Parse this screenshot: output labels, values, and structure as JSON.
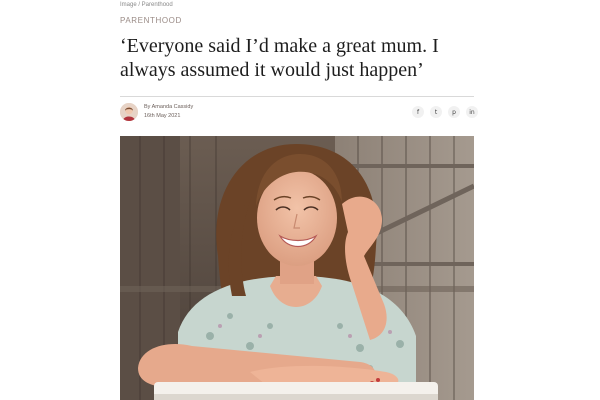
{
  "breadcrumb": "Image / Parenthood",
  "section": "PARENTHOOD",
  "headline": "‘Everyone said I’d make a great mum. I always assumed it would just happen’",
  "byline": {
    "author": "By Amanda Cassidy",
    "date": "16th May 2021"
  },
  "share": {
    "facebook": "f",
    "twitter": "t",
    "pinterest": "p",
    "linkedin": "in"
  },
  "icons": [
    "facebook-icon",
    "twitter-icon",
    "pinterest-icon",
    "linkedin-icon"
  ],
  "colors": {
    "section_label": "#9a8b86",
    "headline": "#1d1d1d",
    "divider": "#d9d9d9"
  }
}
